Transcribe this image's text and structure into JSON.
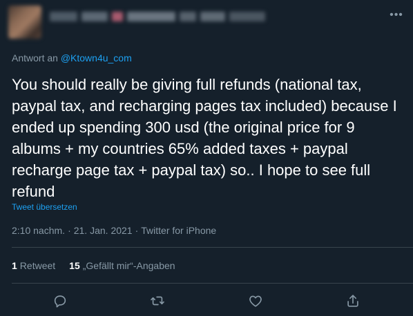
{
  "reply_to": {
    "prefix": "Antwort an",
    "handle": "@Ktown4u_com"
  },
  "tweet": {
    "text": "You should really be giving full refunds (national tax, paypal tax, and recharging pages tax included) because I ended up spending 300 usd (the original price for 9 albums + my countries 65% added taxes + paypal recharge page tax + paypal tax) so.. I hope to see full refund",
    "translate_label": "Tweet übersetzen",
    "time": "2:10 nachm.",
    "date": "21. Jan. 2021",
    "source": "Twitter for iPhone",
    "separator": "·"
  },
  "stats": {
    "retweets_count": "1",
    "retweets_label": "Retweet",
    "likes_count": "15",
    "likes_label": "„Gefällt mir“-Angaben"
  },
  "actions": {
    "icons": [
      "reply-icon",
      "retweet-icon",
      "like-icon",
      "share-icon"
    ]
  },
  "colors": {
    "background": "#15202b",
    "text": "#ffffff",
    "secondary": "#8899a6",
    "accent": "#1da1f2",
    "divider": "#38444d"
  }
}
